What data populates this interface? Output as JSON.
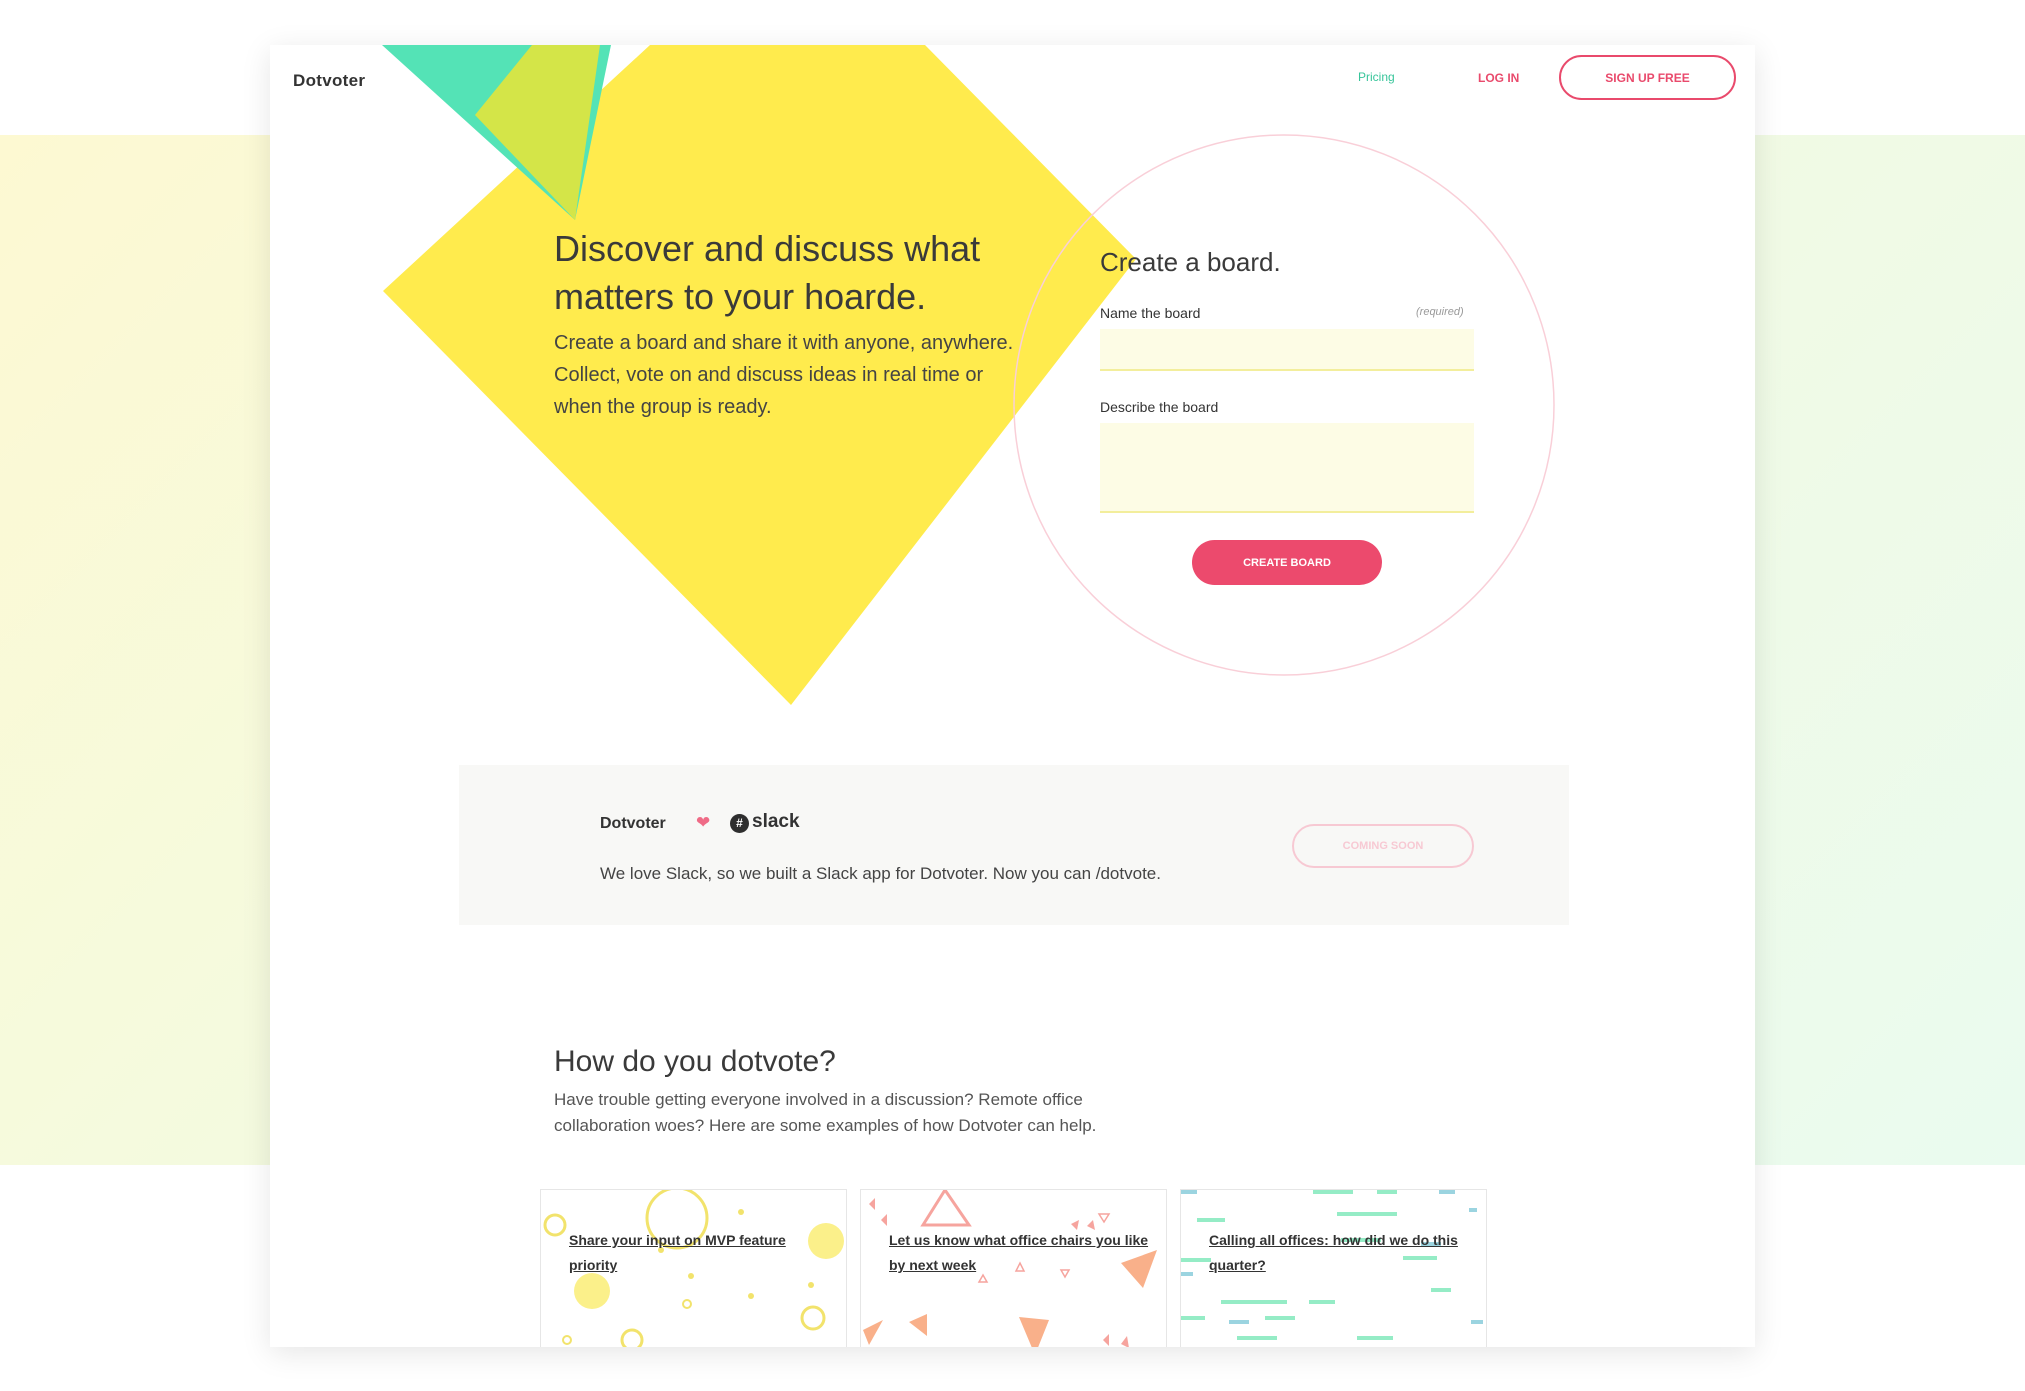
{
  "header": {
    "logo": "Dotvoter",
    "nav": {
      "pricing": "Pricing",
      "login": "LOG IN",
      "signup": "SIGN UP FREE"
    }
  },
  "hero": {
    "title": "Discover and discuss what matters to your hoarde.",
    "description": "Create a board and share it with anyone, anywhere. Collect, vote on and discuss ideas in real time or when the group is ready."
  },
  "create_board": {
    "title": "Create a board.",
    "name_label": "Name the board",
    "required_label": "(required)",
    "name_value": "",
    "describe_label": "Describe the board",
    "describe_value": "",
    "button": "CREATE BOARD"
  },
  "slack": {
    "logo": "Dotvoter",
    "heart_icon": "heart-icon",
    "slack_icon": "slack-logo-icon",
    "slack_word": "slack",
    "description": "We love Slack, so we built a Slack app for Dotvoter. Now you can /dotvote.",
    "button": "COMING SOON"
  },
  "how": {
    "title": "How do you dotvote?",
    "description": "Have trouble getting everyone involved in a discussion? Remote office collaboration woes? Here are some examples of how Dotvoter can help."
  },
  "cards": [
    {
      "title": "Share your input on MVP feature priority"
    },
    {
      "title": "Let us know what office chairs you like by next week"
    },
    {
      "title": "Calling all offices: how did we do this quarter?"
    }
  ],
  "colors": {
    "accent": "#ec4a6d",
    "teal": "#54e3b6",
    "yellow": "#ffeb4d",
    "pricing_green": "#37c59a"
  }
}
